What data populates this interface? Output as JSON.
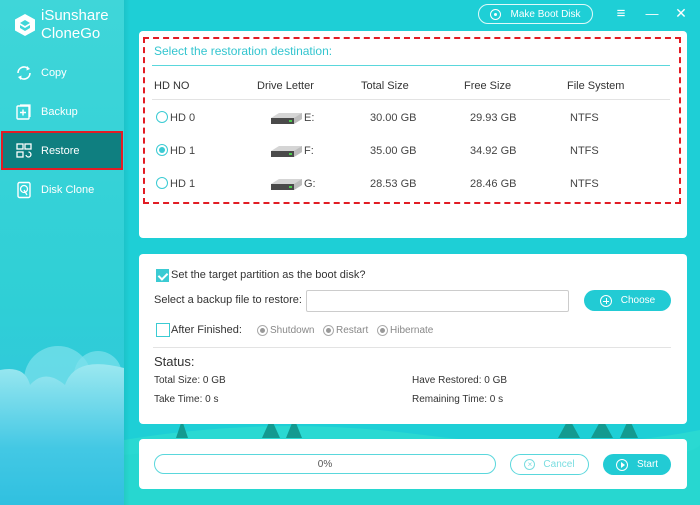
{
  "app": {
    "brand_line1": "iSunshare",
    "brand_line2": "CloneGo",
    "accent_color": "#22cbd4",
    "highlight_color": "#e21c24"
  },
  "sidebar": {
    "items": [
      {
        "label": "Copy",
        "icon": "sync-icon",
        "active": false
      },
      {
        "label": "Backup",
        "icon": "backup-plus-icon",
        "active": false
      },
      {
        "label": "Restore",
        "icon": "restore-icon",
        "active": true
      },
      {
        "label": "Disk Clone",
        "icon": "disk-clone-icon",
        "active": false
      }
    ]
  },
  "topbar": {
    "make_boot_disk": "Make Boot Disk",
    "menu_icon": "≡",
    "minimize_icon": "—",
    "close_icon": "✕"
  },
  "destination": {
    "title": "Select the restoration destination:",
    "columns": [
      "HD NO",
      "Drive Letter",
      "Total Size",
      "Free Size",
      "File System"
    ],
    "rows": [
      {
        "hd": "HD 0",
        "letter": "E:",
        "total": "30.00 GB",
        "free": "29.93 GB",
        "fs": "NTFS",
        "selected": false
      },
      {
        "hd": "HD 1",
        "letter": "F:",
        "total": "35.00 GB",
        "free": "34.92 GB",
        "fs": "NTFS",
        "selected": true
      },
      {
        "hd": "HD 1",
        "letter": "G:",
        "total": "28.53 GB",
        "free": "28.46 GB",
        "fs": "NTFS",
        "selected": false
      }
    ]
  },
  "options": {
    "boot_disk_label": "Set the target partition as the boot disk?",
    "boot_disk_checked": true,
    "backup_file_label": "Select a backup file to restore:",
    "backup_file_value": "",
    "choose_label": "Choose",
    "after_finished_label": "After Finished:",
    "after_finished_checked": false,
    "after_options": [
      "Shutdown",
      "Restart",
      "Hibernate"
    ]
  },
  "status": {
    "heading": "Status:",
    "total_size": "Total Size: 0 GB",
    "have_restored": "Have Restored: 0 GB",
    "take_time": "Take Time: 0 s",
    "remaining_time": "Remaining Time: 0 s"
  },
  "progress": {
    "value_percent": 0,
    "label": "0%",
    "cancel_label": "Cancel",
    "start_label": "Start"
  }
}
